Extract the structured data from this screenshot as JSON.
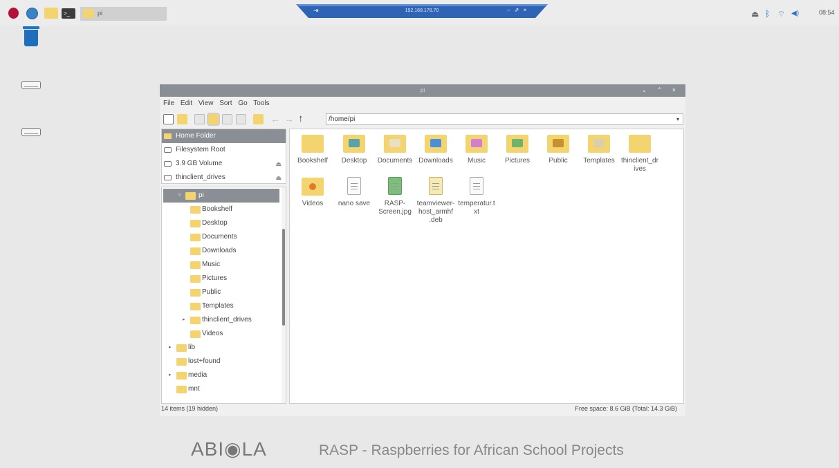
{
  "taskbar": {
    "task_label": "pi",
    "terminal_glyph": ">_",
    "remote_ip": "192.168.178.70",
    "remote_pin": "⇥",
    "remote_controls": "– ⇗ ×",
    "clock": "08:54",
    "tray": {
      "eject": "⏏",
      "bluetooth": "ᛒ",
      "wifi": "⌔",
      "volume": "◀)"
    }
  },
  "window": {
    "title": "pi",
    "controls": "⌄ ⌃ ×",
    "menu": [
      "File",
      "Edit",
      "View",
      "Sort",
      "Go",
      "Tools"
    ],
    "address": "/home/pi",
    "toolbar_arrows": {
      "back": "←",
      "forward": "→",
      "up": "↑",
      "dropdown": "▾"
    }
  },
  "places": [
    {
      "label": "Home Folder",
      "selected": true
    },
    {
      "label": "Filesystem Root",
      "eject": ""
    },
    {
      "label": "3.9 GB Volume",
      "eject": "⏏"
    },
    {
      "label": "thinclient_drives",
      "eject": "⏏"
    }
  ],
  "tree": [
    {
      "label": "pi",
      "level": 0,
      "expander": "▿",
      "selected": true
    },
    {
      "label": "Bookshelf",
      "level": 1
    },
    {
      "label": "Desktop",
      "level": 1
    },
    {
      "label": "Documents",
      "level": 1
    },
    {
      "label": "Downloads",
      "level": 1
    },
    {
      "label": "Music",
      "level": 1
    },
    {
      "label": "Pictures",
      "level": 1
    },
    {
      "label": "Public",
      "level": 1
    },
    {
      "label": "Templates",
      "level": 1
    },
    {
      "label": "thinclient_drives",
      "level": 1,
      "expander": "▸"
    },
    {
      "label": "Videos",
      "level": 1
    },
    {
      "label": "lib",
      "level": -1,
      "expander": "▸"
    },
    {
      "label": "lost+found",
      "level": -1
    },
    {
      "label": "media",
      "level": -1,
      "expander": "▸"
    },
    {
      "label": "mnt",
      "level": -1
    }
  ],
  "items": [
    {
      "label": "Bookshelf",
      "kind": "folder"
    },
    {
      "label": "Desktop",
      "kind": "folder"
    },
    {
      "label": "Documents",
      "kind": "folder"
    },
    {
      "label": "Downloads",
      "kind": "folder"
    },
    {
      "label": "Music",
      "kind": "folder"
    },
    {
      "label": "Pictures",
      "kind": "folder"
    },
    {
      "label": "Public",
      "kind": "folder"
    },
    {
      "label": "Templates",
      "kind": "folder"
    },
    {
      "label": "thinclient_dr ives",
      "kind": "folder"
    },
    {
      "label": "Videos",
      "kind": "folder"
    },
    {
      "label": "nano save",
      "kind": "text"
    },
    {
      "label": "RASP- Screen.jpg",
      "kind": "image"
    },
    {
      "label": "teamviewer- host_armhf .deb",
      "kind": "archive"
    },
    {
      "label": "temperatur.t xt",
      "kind": "text"
    }
  ],
  "status": {
    "left": "14 items (19 hidden)",
    "right": "Free space: 8.6 GiB (Total: 14.3 GiB)"
  },
  "brand": {
    "logo": "ABI◉LA",
    "tagline": "RASP - Raspberries for African School Projects"
  },
  "colors": {
    "folder": "#f3d46f",
    "titlebar": "#8a8f96",
    "selection": "#8a8f96",
    "remote_bar": "#2f63b4"
  }
}
